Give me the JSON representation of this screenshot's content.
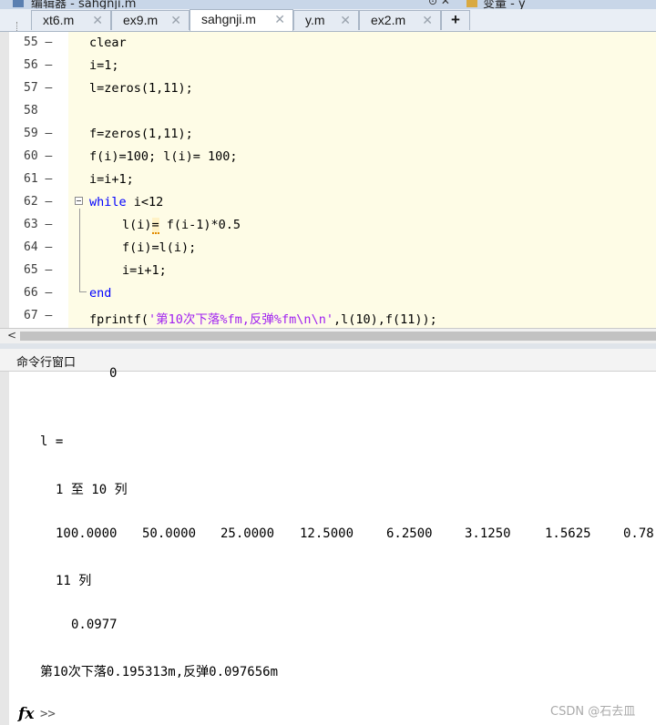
{
  "window": {
    "title": "编辑器 - sahgnji.m",
    "right_title": "变量 - y"
  },
  "tabs": [
    {
      "label": "xt6.m",
      "active": false
    },
    {
      "label": "ex9.m",
      "active": false
    },
    {
      "label": "sahgnji.m",
      "active": true
    },
    {
      "label": "y.m",
      "active": false
    },
    {
      "label": "ex2.m",
      "active": false
    }
  ],
  "tab_add_label": "+",
  "tab_close_glyph": "✕",
  "editor": {
    "lines": [
      {
        "num": "55",
        "mark": "—",
        "code": "clear"
      },
      {
        "num": "56",
        "mark": "—",
        "code": "i=1;"
      },
      {
        "num": "57",
        "mark": "—",
        "code": "l=zeros(1,11);"
      },
      {
        "num": "58",
        "mark": "",
        "code": ""
      },
      {
        "num": "59",
        "mark": "—",
        "code": "f=zeros(1,11);"
      },
      {
        "num": "60",
        "mark": "—",
        "code": "f(i)=100; l(i)= 100;"
      },
      {
        "num": "61",
        "mark": "—",
        "code": "i=i+1;"
      },
      {
        "num": "62",
        "mark": "—",
        "kw": "while",
        "code": " i<12"
      },
      {
        "num": "63",
        "mark": "—",
        "code_a": "l(i)",
        "code_b": "=",
        "code_c": " f(i-1)*0.5"
      },
      {
        "num": "64",
        "mark": "—",
        "code": "f(i)=l(i);"
      },
      {
        "num": "65",
        "mark": "—",
        "code": "i=i+1;"
      },
      {
        "num": "66",
        "mark": "—",
        "kw": "end",
        "code": ""
      },
      {
        "num": "67",
        "mark": "—",
        "code_a": "fprintf(",
        "str": "'第10次下落%fm,反弹%fm\\n\\n'",
        "code_c": ",l(10),f(11));"
      }
    ]
  },
  "hscroll_left": "<",
  "command_window": {
    "header": "命令行窗口",
    "lines": {
      "top_zero": "0",
      "var": "l =",
      "cols_label": "1 至 10 列",
      "values": [
        "100.0000",
        "50.0000",
        "25.0000",
        "12.5000",
        "6.2500",
        "3.1250",
        "1.5625",
        "0.78"
      ],
      "col11_label": "11 列",
      "col11_value": "0.0977",
      "printed": "第10次下落0.195313m,反弹0.097656m"
    },
    "fx": "fx",
    "prompt": ">>"
  },
  "watermark": "CSDN @石去皿"
}
